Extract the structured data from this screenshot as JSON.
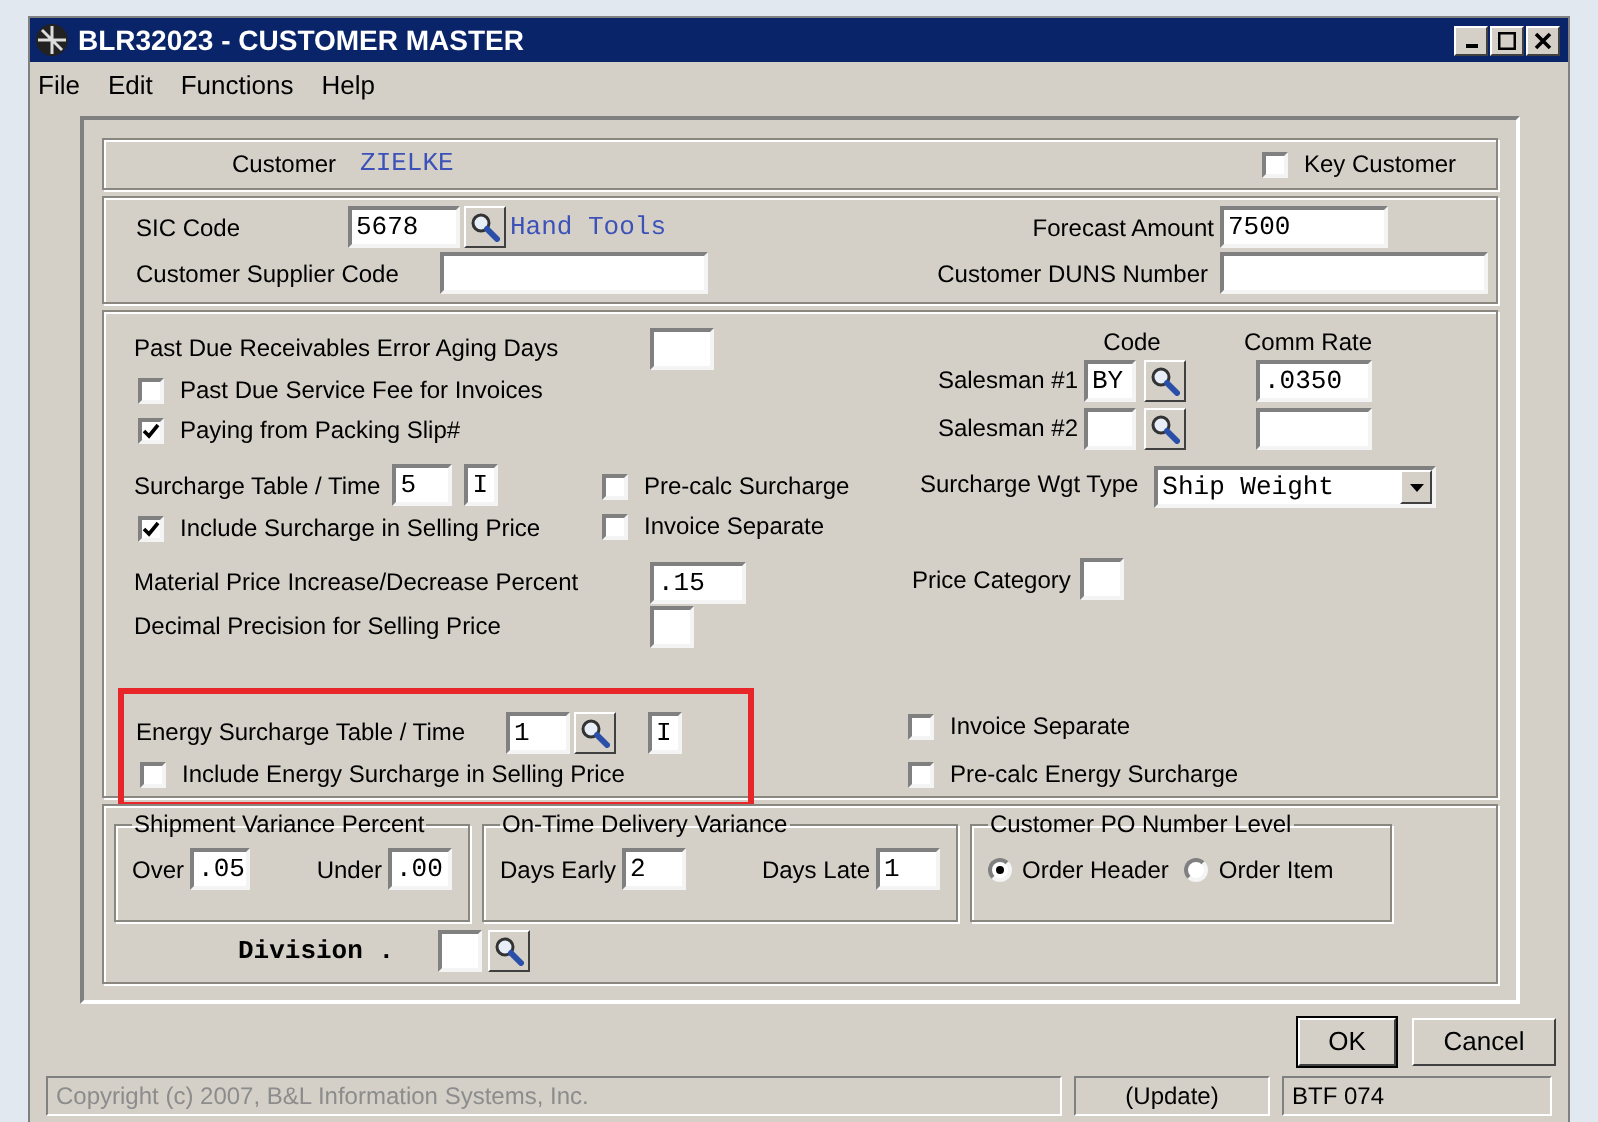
{
  "window": {
    "title": "BLR32023 - CUSTOMER MASTER"
  },
  "menu": [
    "File",
    "Edit",
    "Functions",
    "Help"
  ],
  "customer": {
    "label": "Customer",
    "value": "ZIELKE",
    "key_customer": {
      "label": "Key Customer",
      "checked": false
    }
  },
  "codes": {
    "sic_label": "SIC Code",
    "sic_value": "5678",
    "sic_description": "Hand Tools",
    "supplier_label": "Customer Supplier Code",
    "forecast_label": "Forecast Amount",
    "forecast_value": "7500",
    "duns_label": "Customer DUNS Number"
  },
  "terms": {
    "aging_label": "Past Due Receivables Error Aging Days",
    "checks": [
      {
        "label": "Past Due Service Fee for Invoices",
        "checked": false
      },
      {
        "label": "Paying from Packing Slip#",
        "checked": true
      }
    ],
    "surcharge_label": "Surcharge Table / Time",
    "surcharge_table": "5",
    "surcharge_time": "I",
    "include_surcharge": {
      "label": "Include Surcharge in Selling Price",
      "checked": true
    },
    "precalc": {
      "label": "Pre-calc Surcharge",
      "checked": false
    },
    "invoice_separate": {
      "label": "Invoice Separate",
      "checked": false
    },
    "material_label": "Material Price Increase/Decrease Percent",
    "material_value": ".15",
    "decimal_label": "Decimal Precision for Selling Price",
    "code_header": "Code",
    "rate_header": "Comm Rate",
    "salesmen": [
      {
        "label": "Salesman #1",
        "code": "BY",
        "rate": ".0350"
      },
      {
        "label": "Salesman #2"
      }
    ],
    "wgt_label": "Surcharge Wgt Type",
    "wgt_value": "Ship Weight",
    "price_category_label": "Price Category"
  },
  "energy": {
    "highlighted": true,
    "label": "Energy Surcharge Table / Time",
    "table": "1",
    "time": "I",
    "include": {
      "label": "Include Energy Surcharge in Selling Price",
      "checked": false
    },
    "invoice_separate": {
      "label": "Invoice Separate",
      "checked": false
    },
    "precalc": {
      "label": "Pre-calc Energy Surcharge",
      "checked": false
    }
  },
  "shipment_variance": {
    "title": "Shipment Variance Percent",
    "over_label": "Over",
    "over_value": ".05",
    "under_label": "Under",
    "under_value": ".00"
  },
  "delivery_variance": {
    "title": "On-Time Delivery Variance",
    "early_label": "Days Early",
    "early_value": "2",
    "late_label": "Days Late",
    "late_value": "1"
  },
  "po_level": {
    "title": "Customer PO Number Level",
    "options": [
      {
        "label": "Order Header",
        "selected": true
      },
      {
        "label": "Order Item",
        "selected": false
      }
    ]
  },
  "division": {
    "label": "Division ."
  },
  "buttons": [
    {
      "label": "OK",
      "default": true
    },
    {
      "label": "Cancel",
      "default": false
    }
  ],
  "status_bar": [
    "Copyright (c) 2007, B&L Information Systems, Inc.",
    "(Update)",
    "BTF 074"
  ]
}
